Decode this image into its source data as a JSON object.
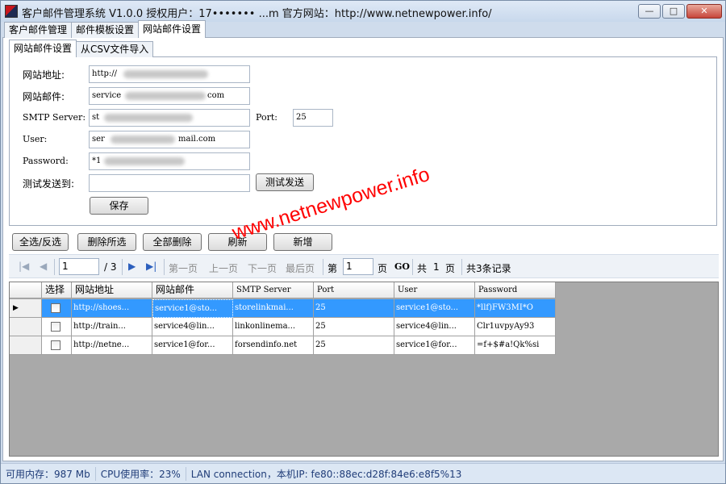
{
  "window": {
    "title": "客户邮件管理系统 V1.0.0 授权用户：17••••••• ...m 官方网站：http://www.netnewpower.info/",
    "minimize": "—",
    "maximize": "□",
    "close": "✕"
  },
  "outer_tabs": [
    "客户邮件管理",
    "邮件模板设置",
    "网站邮件设置"
  ],
  "inner_tabs": [
    "网站邮件设置",
    "从CSV文件导入"
  ],
  "form": {
    "site_url_label": "网站地址:",
    "site_url_value": "http://",
    "site_mail_label": "网站邮件:",
    "site_mail_value": "service",
    "site_mail_suffix": "com",
    "smtp_label": "SMTP Server:",
    "smtp_value": "st",
    "port_label": "Port:",
    "port_value": "25",
    "user_label": "User:",
    "user_value": "ser",
    "user_suffix": "mail.com",
    "password_label": "Password:",
    "password_value": "*1",
    "test_to_label": "测试发送到:",
    "test_to_value": "",
    "test_send_button": "测试发送",
    "save_button": "保存"
  },
  "toolbar": {
    "select_all": "全选/反选",
    "delete_selected": "删除所选",
    "delete_all": "全部删除",
    "refresh": "刷新",
    "add": "新增"
  },
  "pager": {
    "current_page": "1",
    "total_pages": "/ 3",
    "first_page": "第一页",
    "prev_page": "上一页",
    "next_page": "下一页",
    "last_page": "最后页",
    "goto_prefix": "第",
    "goto_value": "1",
    "goto_suffix": "页",
    "go": "GO",
    "total_prefix": "共",
    "total_value": "1",
    "total_suffix": "页",
    "record_count": "共3条记录"
  },
  "grid": {
    "columns": [
      "选择",
      "网站地址",
      "网站邮件",
      "SMTP Server",
      "Port",
      "User",
      "Password"
    ],
    "rows": [
      [
        "http://shoes...",
        "service1@sto...",
        "storelinkmai...",
        "25",
        "service1@sto...",
        "*llf)FW3MI*O"
      ],
      [
        "http://train...",
        "service4@lin...",
        "linkonlinema...",
        "25",
        "service4@lin...",
        "Clr1uvpyAy93"
      ],
      [
        "http://netne...",
        "service1@for...",
        "forsendinfo.net",
        "25",
        "service1@for...",
        "=f+$#a!Qk%si"
      ]
    ]
  },
  "status": {
    "memory": "可用内存：987 Mb",
    "cpu": "CPU使用率：23%",
    "lan": "LAN connection，本机IP: fe80::88ec:d28f:84e6:e8f5%13"
  },
  "watermark": "www.netnewpower.info"
}
